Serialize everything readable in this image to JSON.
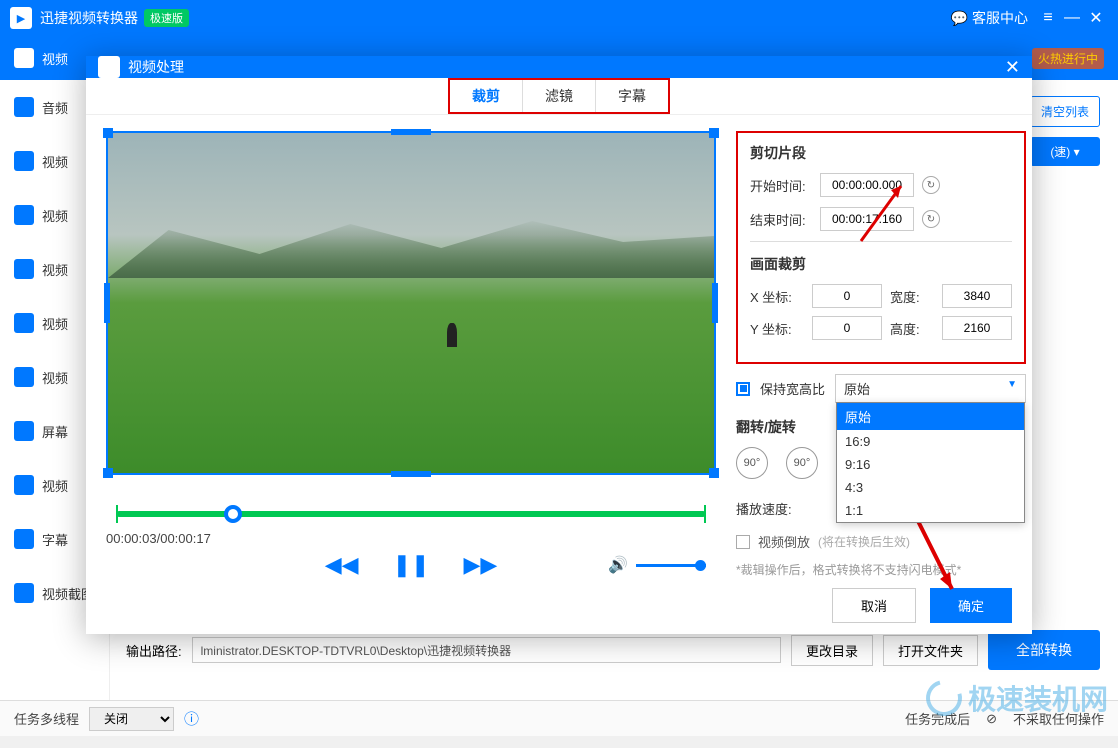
{
  "titlebar": {
    "app_name": "迅捷视频转换器",
    "badge": "极速版",
    "support": "客服中心"
  },
  "toolbar": {
    "first_item": "视频",
    "hot_label": "火热进行中"
  },
  "sidebar": {
    "items": [
      {
        "label": "音频"
      },
      {
        "label": "视频"
      },
      {
        "label": "视频"
      },
      {
        "label": "视频"
      },
      {
        "label": "视频"
      },
      {
        "label": "视频"
      },
      {
        "label": "屏幕"
      },
      {
        "label": "视频"
      },
      {
        "label": "字幕"
      },
      {
        "label": "视频截图"
      }
    ]
  },
  "right_buttons": {
    "clear": "清空列表",
    "speed": "(速) ▾"
  },
  "bottom": {
    "out_label": "输出路径:",
    "path": "lministrator.DESKTOP-TDTVRL0\\Desktop\\迅捷视频转换器",
    "change": "更改目录",
    "open": "打开文件夹",
    "convert": "全部转换"
  },
  "status": {
    "multi_label": "任务多线程",
    "multi_value": "关闭",
    "done_label": "任务完成后",
    "noop": "不采取任何操作"
  },
  "modal": {
    "title": "视频处理",
    "tabs": {
      "crop": "裁剪",
      "filter": "滤镜",
      "subtitle": "字幕"
    },
    "time_display": "00:00:03/00:00:17",
    "clip": {
      "title": "剪切片段",
      "start_label": "开始时间:",
      "start_value": "00:00:00.000",
      "end_label": "结束时间:",
      "end_value": "00:00:17.160"
    },
    "crop": {
      "title": "画面裁剪",
      "x_label": "X 坐标:",
      "x": "0",
      "y_label": "Y 坐标:",
      "y": "0",
      "w_label": "宽度:",
      "w": "3840",
      "h_label": "高度:",
      "h": "2160"
    },
    "aspect": {
      "keep_label": "保持宽高比",
      "selected": "原始",
      "options": [
        "原始",
        "16:9",
        "9:16",
        "4:3",
        "1:1"
      ]
    },
    "flip": {
      "title": "翻转/旋转",
      "l90": "90°",
      "r90": "90°"
    },
    "speed": {
      "label": "播放速度:"
    },
    "reverse": {
      "label": "视频倒放",
      "hint": "(将在转换后生效)"
    },
    "note": "*裁辑操作后，格式转换将不支持闪电模式*",
    "footer": {
      "cancel": "取消",
      "ok": "确定"
    }
  },
  "watermark": "极速装机网"
}
